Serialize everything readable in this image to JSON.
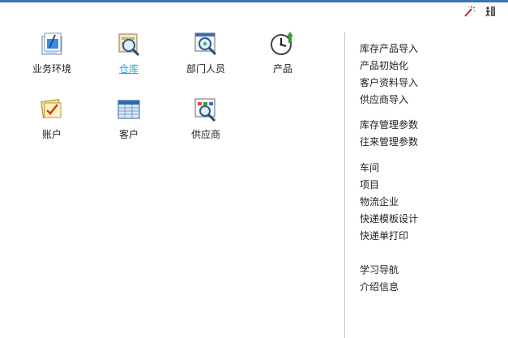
{
  "tiles": [
    {
      "label": "业务环境",
      "icon": "business-environment-icon"
    },
    {
      "label": "仓库",
      "icon": "warehouse-icon"
    },
    {
      "label": "部门人员",
      "icon": "department-staff-icon"
    },
    {
      "label": "产品",
      "icon": "product-clock-icon"
    },
    {
      "label": "账户",
      "icon": "account-icon"
    },
    {
      "label": "客户",
      "icon": "customer-icon"
    },
    {
      "label": "供应商",
      "icon": "supplier-icon"
    }
  ],
  "panel": {
    "group1": [
      "库存产品导入",
      "产品初始化",
      "客户资料导入",
      "供应商导入"
    ],
    "group2": [
      "库存管理参数",
      "往来管理参数"
    ],
    "group3": [
      "车间",
      "项目",
      "物流企业",
      "快递模板设计",
      "快递单打印"
    ],
    "group4": [
      "学习导航",
      "介绍信息"
    ]
  },
  "toolbar": {
    "tool_icons": [
      "magic-wand-icon",
      "exit-door-icon"
    ]
  },
  "colors": {
    "accent_bar": "#3c73b8",
    "link": "#2aa3c9"
  }
}
